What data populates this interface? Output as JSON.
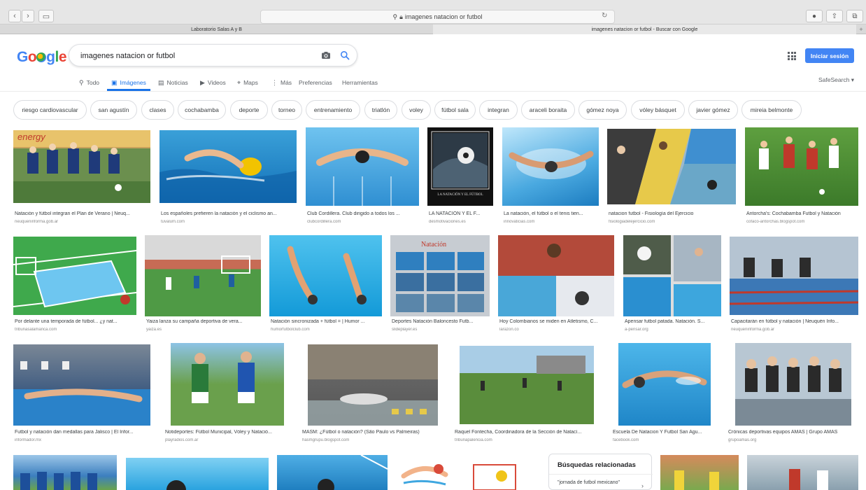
{
  "browser": {
    "address": "imagenes natacion or futbol",
    "tabs": [
      "Laboratorio Salas A y B",
      "imagenes natacion or futbol - Buscar con Google"
    ]
  },
  "search": {
    "query": "imagenes natacion or futbol",
    "signin_label": "Iniciar sesión",
    "safesearch": "SafeSearch ▾"
  },
  "menu": [
    {
      "icon": "search-icon",
      "glyph": "⚲",
      "label": "Todo"
    },
    {
      "icon": "image-icon",
      "glyph": "▣",
      "label": "Imágenes"
    },
    {
      "icon": "news-icon",
      "glyph": "▤",
      "label": "Noticias"
    },
    {
      "icon": "video-icon",
      "glyph": "▶",
      "label": "Videos"
    },
    {
      "icon": "maps-icon",
      "glyph": "⌖",
      "label": "Maps"
    },
    {
      "icon": "more-icon",
      "glyph": "⋮",
      "label": "Más"
    },
    {
      "icon": "",
      "glyph": "",
      "label": "Preferencias"
    },
    {
      "icon": "",
      "glyph": "",
      "label": "Herramientas"
    }
  ],
  "chips": [
    "riesgo cardiovascular",
    "san agustín",
    "clases",
    "cochabamba",
    "deporte",
    "torneo",
    "entrenamiento",
    "triatlón",
    "voley",
    "fútbol sala",
    "integran",
    "araceli boraita",
    "gómez noya",
    "vóley básquet",
    "javier gómez",
    "mireia belmonte"
  ],
  "results": [
    {
      "caption": "Natación y fútbol integran el Plan de Verano | Neuq...",
      "source": "neuqueninforma.gob.ar"
    },
    {
      "caption": "Los españoles prefieren la natación y el ciclismo an...",
      "source": "tuvalum.com"
    },
    {
      "caption": "Club Cordillera. Club dirigido a todos los ...",
      "source": "clubcordillera.com"
    },
    {
      "caption": "LA NATACIÓN Y EL F...",
      "source": "desmotivaciones.es"
    },
    {
      "caption": "La natación, el fútbol o el tenis tien...",
      "source": "innovaticias.com"
    },
    {
      "caption": "natacion futbol - Fisiología del Ejercicio",
      "source": "fisiologiadelejercicio.com"
    },
    {
      "caption": "Antorcha's: Cochabamba Futbol y Natación",
      "source": "cofaco-antorchas.blogspot.com"
    },
    {
      "caption": "Por delante una temporada de fútbol... ¿y nat...",
      "source": "tribunasalamanca.com"
    },
    {
      "caption": "Yaiza lanza su campaña deportiva de vera...",
      "source": "yaiza.es"
    },
    {
      "caption": "Natación sincronizada + fútbol = | Humor ...",
      "source": "humorfutbolclub.com"
    },
    {
      "caption": "Deportes Natación Baloncesto Futb...",
      "source": "slideplayer.es"
    },
    {
      "caption": "Hoy Colombianos se miden en Atletismo, C...",
      "source": "larazon.co"
    },
    {
      "caption": "Apensar futbol patada. Natación. S...",
      "source": "a-pensar.org"
    },
    {
      "caption": "Capacitarán en fútbol y natación | Neuquén Info...",
      "source": "neuqueninforma.gob.ar"
    },
    {
      "caption": "Futbol y natación dan medallas para Jalisco | El Infor...",
      "source": "informador.mx"
    },
    {
      "caption": "Notideportes: Fútbol Municipal, Vóley y Natació...",
      "source": "playradios.com.ar"
    },
    {
      "caption": "MASM: ¿Fútbol o natación? (São Paulo vs Palmeiras)",
      "source": "hasmgrupu.blogspot.com"
    },
    {
      "caption": "Raquel Fontecha, Coordinadora de la Sección de Natací...",
      "source": "tribunapalencia.com"
    },
    {
      "caption": "Escuela De Natacion Y Futbol San Agu...",
      "source": "facebook.com"
    },
    {
      "caption": "Crónicas deportivas equipos AMÁS | Grupo AMÁS",
      "source": "grupoamas.org"
    }
  ],
  "image_overlays": {
    "natacion_title": "Natación",
    "poster_text": "LA NATACIÓN Y EL FÚTBOL"
  },
  "related": {
    "title": "Búsquedas relacionadas",
    "item": "\"jornada de futbol mexicano\""
  }
}
